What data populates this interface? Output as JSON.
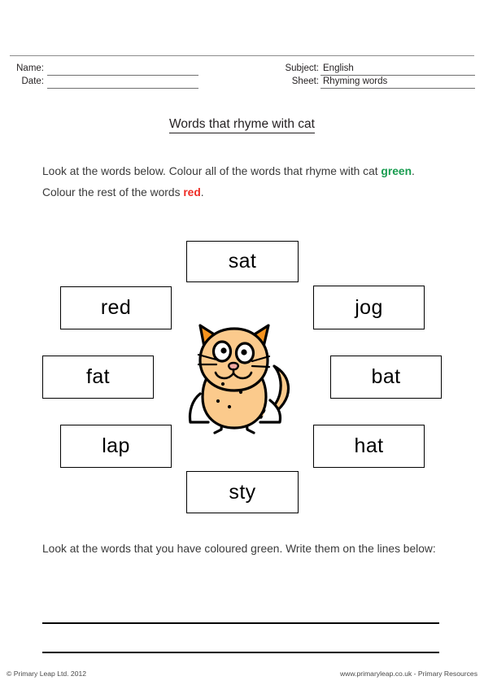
{
  "header": {
    "name_label": "Name:",
    "name_value": "",
    "date_label": "Date:",
    "date_value": "",
    "subject_label": "Subject:",
    "subject_value": "English",
    "sheet_label": "Sheet:",
    "sheet_value": "Rhyming words"
  },
  "title": "Words that rhyme with cat",
  "instructions": {
    "first_part_a": "Look at the words below. Colour all of the words that rhyme with cat ",
    "green_word": "green",
    "first_part_b": ". Colour the rest of the words ",
    "red_word": "red",
    "first_part_c": ".",
    "second": "Look at the words that you have coloured green. Write them on the lines below:"
  },
  "colors": {
    "green": "#189c4f",
    "red": "#ee2c25",
    "cat_body": "#fbca8c",
    "cat_ear": "#f7941e",
    "cat_nose": "#f2a9a2",
    "outline": "#000000",
    "rule_gray": "#8c8c8c"
  },
  "word_boxes": [
    {
      "id": "sat",
      "label": "sat",
      "position": "top-center"
    },
    {
      "id": "red",
      "label": "red",
      "position": "left-upper"
    },
    {
      "id": "jog",
      "label": "jog",
      "position": "right-upper"
    },
    {
      "id": "fat",
      "label": "fat",
      "position": "left-middle"
    },
    {
      "id": "bat",
      "label": "bat",
      "position": "right-middle"
    },
    {
      "id": "lap",
      "label": "lap",
      "position": "left-lower"
    },
    {
      "id": "hat",
      "label": "hat",
      "position": "right-lower"
    },
    {
      "id": "sty",
      "label": "sty",
      "position": "bottom-center"
    }
  ],
  "illustration": {
    "name": "cat",
    "alt": "Cartoon orange cat sitting"
  },
  "answer_lines": [
    {
      "id": 1,
      "value": ""
    },
    {
      "id": 2,
      "value": ""
    }
  ],
  "footer": {
    "copyright": "© Primary Leap Ltd. 2012",
    "website": "www.primaryleap.co.uk  -  Primary Resources"
  }
}
